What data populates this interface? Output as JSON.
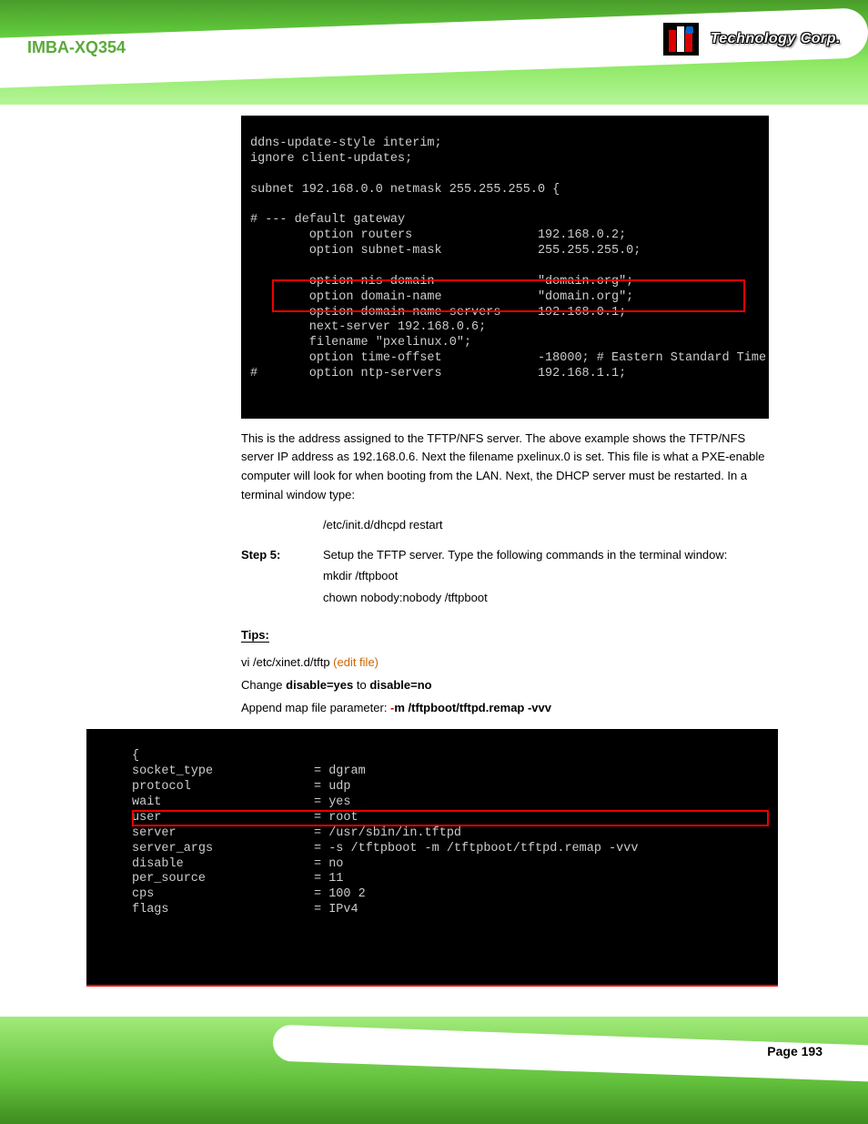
{
  "header": {
    "product": "IMBA-XQ354",
    "brand_reg": "®",
    "brand_text": "Technology Corp."
  },
  "terminal1": {
    "l1": "ddns-update-style interim;",
    "l2": "ignore client-updates;",
    "l3": "subnet 192.168.0.0 netmask 255.255.255.0 {",
    "l4": "# --- default gateway",
    "l5": "        option routers                 192.168.0.2;",
    "l6": "        option subnet-mask             255.255.255.0;",
    "l7": "        option nis-domain              \"domain.org\";",
    "l8": "        option domain-name             \"domain.org\";",
    "l9": "        option domain-name-servers     192.168.0.1;",
    "l10": "        next-server 192.168.0.6;",
    "l11": "        filename \"pxelinux.0\";",
    "l12": "        option time-offset             -18000; # Eastern Standard Time",
    "l13": "#       option ntp-servers             192.168.1.1;"
  },
  "note": "This is the address assigned to the TFTP/NFS server. The above example shows the TFTP/NFS server IP address as 192.168.0.6. Next the filename pxelinux.0 is set. This file is what a PXE-enable computer will look for when booting from the LAN. Next, the DHCP server must be restarted. In a terminal window type:",
  "cmd1": "/etc/init.d/dhcpd restart",
  "step5": {
    "label": "Step 5:",
    "text": "Setup the TFTP server. Type the following commands in the terminal window:"
  },
  "cmd2a": "mkdir /tftpboot",
  "cmd2b": "chown nobody:nobody /tftpboot",
  "tip": {
    "label": "Tips:",
    "file_prefix": "vi /etc/xinet.d/tftp ",
    "file_suffix": "(edit file)"
  },
  "tip_line1_a": "Change ",
  "tip_line1_b": "disable=yes",
  "tip_line1_c": " to ",
  "tip_line1_d": "disable=no",
  "tip_line2_a": "Append map file parameter: ",
  "tip_line2_b": "-",
  "tip_line2_c": "m /tftpboot/tftpd.remap -vvv",
  "terminal2": {
    "r1k": "socket_type",
    "r1v": "= dgram",
    "r2k": "protocol",
    "r2v": "= udp",
    "r3k": "wait",
    "r3v": "= yes",
    "r4k": "user",
    "r4v": "= root",
    "r5k": "server",
    "r5v": "= /usr/sbin/in.tftpd",
    "r6k": "server_args",
    "r6v": "= -s /tftpboot -m /tftpboot/tftpd.remap -vvv",
    "r7k": "disable",
    "r7v": "= no",
    "r8k": "per_source",
    "r8v": "= 11",
    "r9k": "cps",
    "r9v": "= 100 2",
    "r10k": "flags",
    "r10v": "= IPv4"
  },
  "footer": {
    "page": "Page 193"
  }
}
